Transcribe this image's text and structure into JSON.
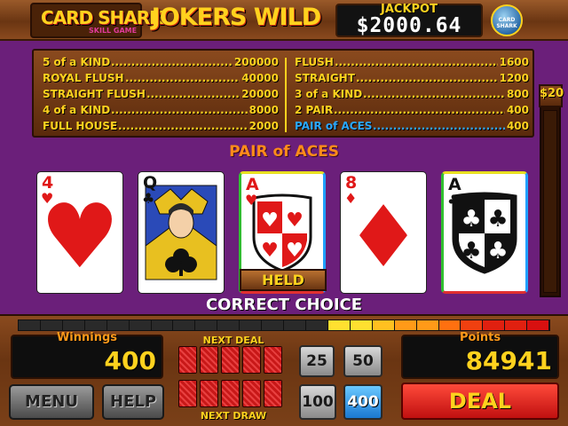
{
  "header": {
    "brand_name": "CARD SHARK",
    "brand_sub": "SKILL GAME",
    "game_title": "JOKERS WILD",
    "jackpot_label": "JACKPOT",
    "jackpot_value": "$2000.64",
    "logo_text": "CARD SHARK"
  },
  "paytable": {
    "left": [
      {
        "label": "5 of a KIND",
        "amount": "200000"
      },
      {
        "label": "ROYAL FLUSH",
        "amount": "40000"
      },
      {
        "label": "STRAIGHT FLUSH",
        "amount": "20000"
      },
      {
        "label": "4 of a KIND",
        "amount": "8000"
      },
      {
        "label": "FULL HOUSE",
        "amount": "2000"
      }
    ],
    "right": [
      {
        "label": "FLUSH",
        "amount": "1600"
      },
      {
        "label": "STRAIGHT",
        "amount": "1200"
      },
      {
        "label": "3 of a KIND",
        "amount": "800"
      },
      {
        "label": "2 PAIR",
        "amount": "400"
      },
      {
        "label": "PAIR of ACES",
        "amount": "400",
        "highlight": true
      }
    ]
  },
  "bet_meter": {
    "label": "$20"
  },
  "hand_result": "PAIR of ACES",
  "cards": [
    {
      "rank": "4",
      "suit": "hearts",
      "color": "red",
      "held": false
    },
    {
      "rank": "Q",
      "suit": "clubs",
      "color": "black",
      "held": false
    },
    {
      "rank": "A",
      "suit": "hearts",
      "color": "red",
      "held": true
    },
    {
      "rank": "8",
      "suit": "diamonds",
      "color": "red",
      "held": false
    },
    {
      "rank": "A",
      "suit": "clubs",
      "color": "black",
      "held": true
    }
  ],
  "held_label": "HELD",
  "status_text": "CORRECT CHOICE",
  "progress_colors": [
    "#2a2a2a",
    "#2a2a2a",
    "#2a2a2a",
    "#2a2a2a",
    "#2a2a2a",
    "#2a2a2a",
    "#2a2a2a",
    "#2a2a2a",
    "#2a2a2a",
    "#2a2a2a",
    "#2a2a2a",
    "#2a2a2a",
    "#2a2a2a",
    "#2a2a2a",
    "#ffe030",
    "#ffe030",
    "#ffc020",
    "#ff9a18",
    "#ff9a18",
    "#ff7010",
    "#f04010",
    "#e02010",
    "#e02010",
    "#d81010"
  ],
  "winnings": {
    "label": "Winnings",
    "value": "400"
  },
  "points": {
    "label": "Points",
    "value": "84941"
  },
  "next_deal_label": "NEXT DEAL",
  "next_draw_label": "NEXT DRAW",
  "buttons": {
    "menu": "MENU",
    "help": "HELP",
    "bet_25": "25",
    "bet_50": "50",
    "bet_100": "100",
    "bet_400": "400",
    "deal": "DEAL"
  }
}
